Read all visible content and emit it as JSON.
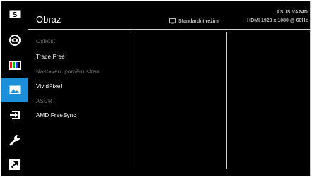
{
  "header": {
    "title": "Obraz",
    "model": "ASUS VA24D",
    "mode_label": "Standardní režim",
    "signal": "HDMI 1920 x 1080 @ 60Hz"
  },
  "sidebar": {
    "items": [
      {
        "icon": "splendid-s-icon",
        "active": false
      },
      {
        "icon": "eye-care-icon",
        "active": false
      },
      {
        "icon": "color-bars-icon",
        "active": false
      },
      {
        "icon": "image-icon",
        "active": true
      },
      {
        "icon": "input-select-icon",
        "active": false
      },
      {
        "icon": "wrench-icon",
        "active": false
      },
      {
        "icon": "shortcut-arrow-icon",
        "active": false
      }
    ]
  },
  "menu": {
    "items": [
      {
        "label": "Ostrost",
        "enabled": false
      },
      {
        "label": "Trace Free",
        "enabled": true
      },
      {
        "label": "Nastavení poměru stran",
        "enabled": false
      },
      {
        "label": "VividPixel",
        "enabled": true
      },
      {
        "label": "ASCR",
        "enabled": false
      },
      {
        "label": "AMD FreeSync",
        "enabled": true
      }
    ]
  },
  "colors": {
    "background": "#000000",
    "accent": "#1b8fd8",
    "text_enabled": "#ffffff",
    "text_disabled": "#6f6f6f"
  }
}
